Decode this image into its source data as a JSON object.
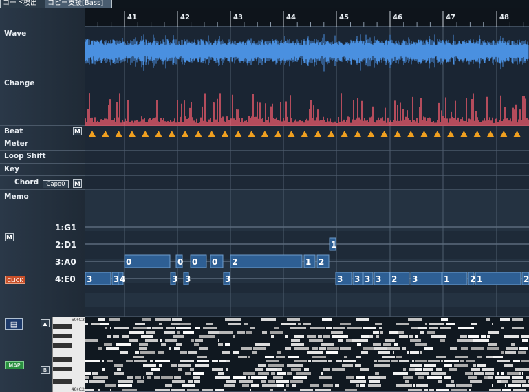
{
  "tabs": [
    {
      "label": "コード検出",
      "active": false
    },
    {
      "label": "コピー支援[Bass]",
      "active": true
    }
  ],
  "ruler": {
    "measures": [
      "41",
      "42",
      "43",
      "44",
      "45",
      "46",
      "47",
      "48"
    ]
  },
  "tracks": {
    "wave": "Wave",
    "change": "Change",
    "beat": "Beat",
    "meter": "Meter",
    "loop_shift": "Loop Shift",
    "key": "Key",
    "chord": "Chord",
    "memo": "Memo"
  },
  "buttons": {
    "m": "M",
    "capo": "Capo0",
    "click": "CLICK",
    "map": "MAP",
    "up": "▲",
    "b": "B"
  },
  "strings": [
    "1:G1",
    "2:D1",
    "3:A0",
    "4:E0"
  ],
  "piano": {
    "top": "60(C3",
    "bottom": "48(C2"
  },
  "tab_notes": [
    {
      "string": 2,
      "fret": "1",
      "start": 355,
      "end": 364
    },
    {
      "string": 3,
      "fret": "0",
      "start": 57,
      "end": 123
    },
    {
      "string": 3,
      "fret": "0",
      "start": 132,
      "end": 141
    },
    {
      "string": 3,
      "fret": "0",
      "start": 153,
      "end": 176
    },
    {
      "string": 3,
      "fret": "0",
      "start": 182,
      "end": 200
    },
    {
      "string": 3,
      "fret": "2",
      "start": 211,
      "end": 315
    },
    {
      "string": 3,
      "fret": "1",
      "start": 318,
      "end": 334
    },
    {
      "string": 3,
      "fret": "2",
      "start": 337,
      "end": 354
    },
    {
      "string": 4,
      "fret": "3",
      "start": 0,
      "end": 37
    },
    {
      "string": 4,
      "fret": "3",
      "start": 39,
      "end": 48
    },
    {
      "string": 4,
      "fret": "4",
      "start": 48,
      "end": 55
    },
    {
      "string": 4,
      "fret": "3",
      "start": 124,
      "end": 131
    },
    {
      "string": 4,
      "fret": "3",
      "start": 143,
      "end": 150
    },
    {
      "string": 4,
      "fret": "3",
      "start": 201,
      "end": 210
    },
    {
      "string": 4,
      "fret": "3",
      "start": 364,
      "end": 387
    },
    {
      "string": 4,
      "fret": "3",
      "start": 389,
      "end": 403
    },
    {
      "string": 4,
      "fret": "3",
      "start": 404,
      "end": 418
    },
    {
      "string": 4,
      "fret": "3",
      "start": 420,
      "end": 442
    },
    {
      "string": 4,
      "fret": "2",
      "start": 443,
      "end": 471
    },
    {
      "string": 4,
      "fret": "3",
      "start": 473,
      "end": 518
    },
    {
      "string": 4,
      "fret": "1",
      "start": 519,
      "end": 555
    },
    {
      "string": 4,
      "fret": "2",
      "start": 557,
      "end": 565
    },
    {
      "string": 4,
      "fret": "1",
      "start": 567,
      "end": 633
    },
    {
      "string": 4,
      "fret": "2",
      "start": 635,
      "end": 645
    }
  ],
  "colors": {
    "wave": "#4a90e0",
    "change": "#e85a6a",
    "beat": "#f0a020",
    "tab_note": "#2e5f94",
    "lane_bg": "#1a2533"
  }
}
